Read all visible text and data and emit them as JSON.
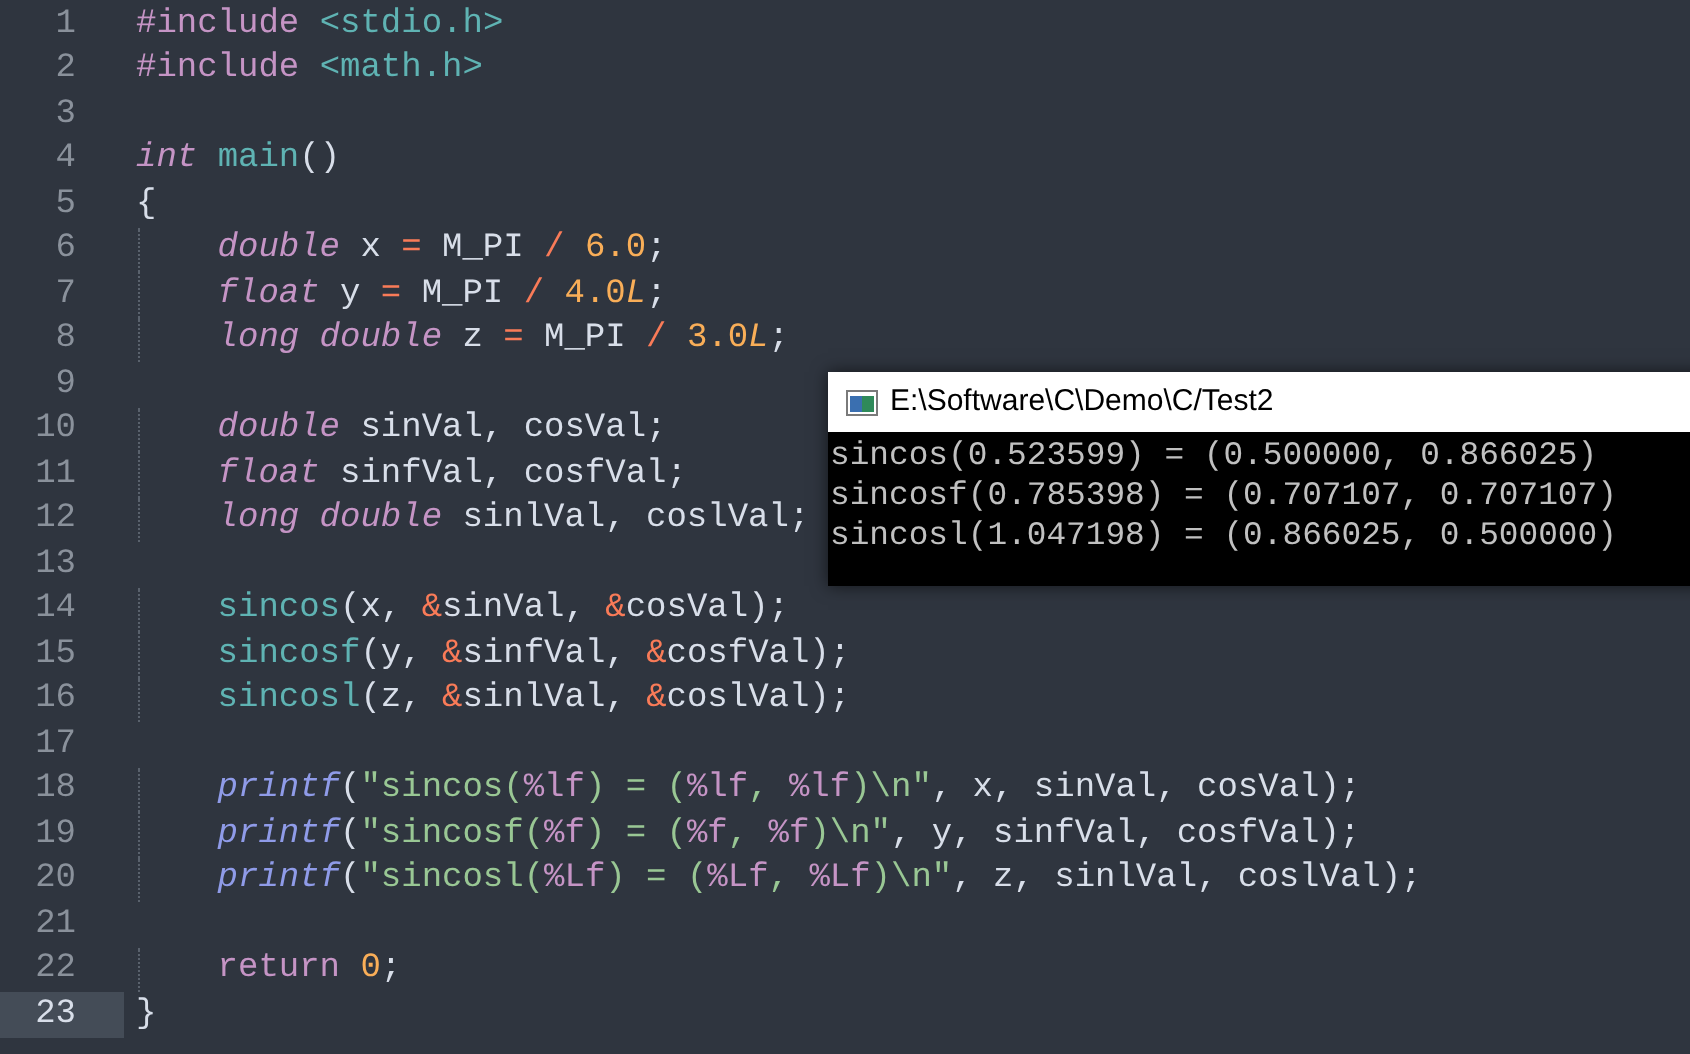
{
  "editor": {
    "lines": [
      {
        "number": "1",
        "current": false,
        "indented": false,
        "tokens": [
          {
            "kind": "directive",
            "text": "#include "
          },
          {
            "kind": "path",
            "text": "<stdio.h>"
          }
        ]
      },
      {
        "number": "2",
        "current": false,
        "indented": false,
        "tokens": [
          {
            "kind": "directive",
            "text": "#include "
          },
          {
            "kind": "path",
            "text": "<math.h>"
          }
        ]
      },
      {
        "number": "3",
        "current": false,
        "indented": false
      },
      {
        "number": "4",
        "current": false,
        "indented": false,
        "tokens": [
          {
            "kind": "type",
            "text": "int "
          },
          {
            "kind": "func",
            "text": "main"
          },
          {
            "kind": "plain",
            "text": "()"
          }
        ]
      },
      {
        "number": "5",
        "current": false,
        "indented": false,
        "tokens": [
          {
            "kind": "plain",
            "text": "{"
          }
        ]
      },
      {
        "number": "6",
        "current": false,
        "indented": true,
        "tokens": [
          {
            "kind": "type",
            "text": "double"
          },
          {
            "kind": "plain",
            "text": " x "
          },
          {
            "kind": "op",
            "text": "="
          },
          {
            "kind": "plain",
            "text": " M_PI "
          },
          {
            "kind": "op",
            "text": "/ "
          },
          {
            "kind": "num",
            "text": "6.0"
          },
          {
            "kind": "plain",
            "text": ";"
          }
        ]
      },
      {
        "number": "7",
        "current": false,
        "indented": true,
        "tokens": [
          {
            "kind": "type",
            "text": "float"
          },
          {
            "kind": "plain",
            "text": " y "
          },
          {
            "kind": "op",
            "text": "="
          },
          {
            "kind": "plain",
            "text": " M_PI "
          },
          {
            "kind": "op",
            "text": "/ "
          },
          {
            "kind": "num",
            "text": "4.0"
          },
          {
            "kind": "suffix",
            "text": "L"
          },
          {
            "kind": "plain",
            "text": ";"
          }
        ]
      },
      {
        "number": "8",
        "current": false,
        "indented": true,
        "tokens": [
          {
            "kind": "type",
            "text": "long double"
          },
          {
            "kind": "plain",
            "text": " z "
          },
          {
            "kind": "op",
            "text": "="
          },
          {
            "kind": "plain",
            "text": " M_PI "
          },
          {
            "kind": "op",
            "text": "/ "
          },
          {
            "kind": "num",
            "text": "3.0"
          },
          {
            "kind": "suffix",
            "text": "L"
          },
          {
            "kind": "plain",
            "text": ";"
          }
        ]
      },
      {
        "number": "9",
        "current": false,
        "indented": false
      },
      {
        "number": "10",
        "current": false,
        "indented": true,
        "tokens": [
          {
            "kind": "type",
            "text": "double"
          },
          {
            "kind": "plain",
            "text": " sinVal, cosVal;"
          }
        ]
      },
      {
        "number": "11",
        "current": false,
        "indented": true,
        "tokens": [
          {
            "kind": "type",
            "text": "float"
          },
          {
            "kind": "plain",
            "text": " sinfVal, cosfVal;"
          }
        ]
      },
      {
        "number": "12",
        "current": false,
        "indented": true,
        "tokens": [
          {
            "kind": "type",
            "text": "long double"
          },
          {
            "kind": "plain",
            "text": " sinlVal, coslVal;"
          }
        ]
      },
      {
        "number": "13",
        "current": false,
        "indented": false
      },
      {
        "number": "14",
        "current": false,
        "indented": true,
        "tokens": [
          {
            "kind": "func",
            "text": "sincos"
          },
          {
            "kind": "plain",
            "text": "(x, "
          },
          {
            "kind": "op",
            "text": "&"
          },
          {
            "kind": "plain",
            "text": "sinVal, "
          },
          {
            "kind": "op",
            "text": "&"
          },
          {
            "kind": "plain",
            "text": "cosVal);"
          }
        ]
      },
      {
        "number": "15",
        "current": false,
        "indented": true,
        "tokens": [
          {
            "kind": "func",
            "text": "sincosf"
          },
          {
            "kind": "plain",
            "text": "(y, "
          },
          {
            "kind": "op",
            "text": "&"
          },
          {
            "kind": "plain",
            "text": "sinfVal, "
          },
          {
            "kind": "op",
            "text": "&"
          },
          {
            "kind": "plain",
            "text": "cosfVal);"
          }
        ]
      },
      {
        "number": "16",
        "current": false,
        "indented": true,
        "tokens": [
          {
            "kind": "func",
            "text": "sincosl"
          },
          {
            "kind": "plain",
            "text": "(z, "
          },
          {
            "kind": "op",
            "text": "&"
          },
          {
            "kind": "plain",
            "text": "sinlVal, "
          },
          {
            "kind": "op",
            "text": "&"
          },
          {
            "kind": "plain",
            "text": "coslVal);"
          }
        ]
      },
      {
        "number": "17",
        "current": false,
        "indented": false
      },
      {
        "number": "18",
        "current": false,
        "indented": true,
        "tokens": [
          {
            "kind": "call",
            "text": "printf"
          },
          {
            "kind": "plain",
            "text": "("
          },
          {
            "kind": "str",
            "text": "\"sincos("
          },
          {
            "kind": "format",
            "text": "%lf"
          },
          {
            "kind": "str",
            "text": ") = ("
          },
          {
            "kind": "format",
            "text": "%lf"
          },
          {
            "kind": "str",
            "text": ", "
          },
          {
            "kind": "format",
            "text": "%lf"
          },
          {
            "kind": "str",
            "text": ")\\n\""
          },
          {
            "kind": "plain",
            "text": ", x, sinVal, cosVal);"
          }
        ]
      },
      {
        "number": "19",
        "current": false,
        "indented": true,
        "tokens": [
          {
            "kind": "call",
            "text": "printf"
          },
          {
            "kind": "plain",
            "text": "("
          },
          {
            "kind": "str",
            "text": "\"sincosf("
          },
          {
            "kind": "format",
            "text": "%f"
          },
          {
            "kind": "str",
            "text": ") = ("
          },
          {
            "kind": "format",
            "text": "%f"
          },
          {
            "kind": "str",
            "text": ", "
          },
          {
            "kind": "format",
            "text": "%f"
          },
          {
            "kind": "str",
            "text": ")\\n\""
          },
          {
            "kind": "plain",
            "text": ", y, sinfVal, cosfVal);"
          }
        ]
      },
      {
        "number": "20",
        "current": false,
        "indented": true,
        "tokens": [
          {
            "kind": "call",
            "text": "printf"
          },
          {
            "kind": "plain",
            "text": "("
          },
          {
            "kind": "str",
            "text": "\"sincosl("
          },
          {
            "kind": "format",
            "text": "%Lf"
          },
          {
            "kind": "str",
            "text": ") = ("
          },
          {
            "kind": "format",
            "text": "%Lf"
          },
          {
            "kind": "str",
            "text": ", "
          },
          {
            "kind": "format",
            "text": "%Lf"
          },
          {
            "kind": "str",
            "text": ")\\n\""
          },
          {
            "kind": "plain",
            "text": ", z, sinlVal, coslVal);"
          }
        ]
      },
      {
        "number": "21",
        "current": false,
        "indented": false
      },
      {
        "number": "22",
        "current": false,
        "indented": true,
        "tokens": [
          {
            "kind": "keyword",
            "text": "return "
          },
          {
            "kind": "num",
            "text": "0"
          },
          {
            "kind": "plain",
            "text": ";"
          }
        ]
      },
      {
        "number": "23",
        "current": true,
        "indented": false,
        "tokens": [
          {
            "kind": "plain",
            "text": "}"
          }
        ]
      }
    ]
  },
  "console": {
    "title": "E:\\Software\\C\\Demo\\C/Test2",
    "output": [
      "sincos(0.523599) = (0.500000, 0.866025)",
      "sincosf(0.785398) = (0.707107, 0.707107)",
      "sincosl(1.047198) = (0.866025, 0.500000)"
    ]
  }
}
